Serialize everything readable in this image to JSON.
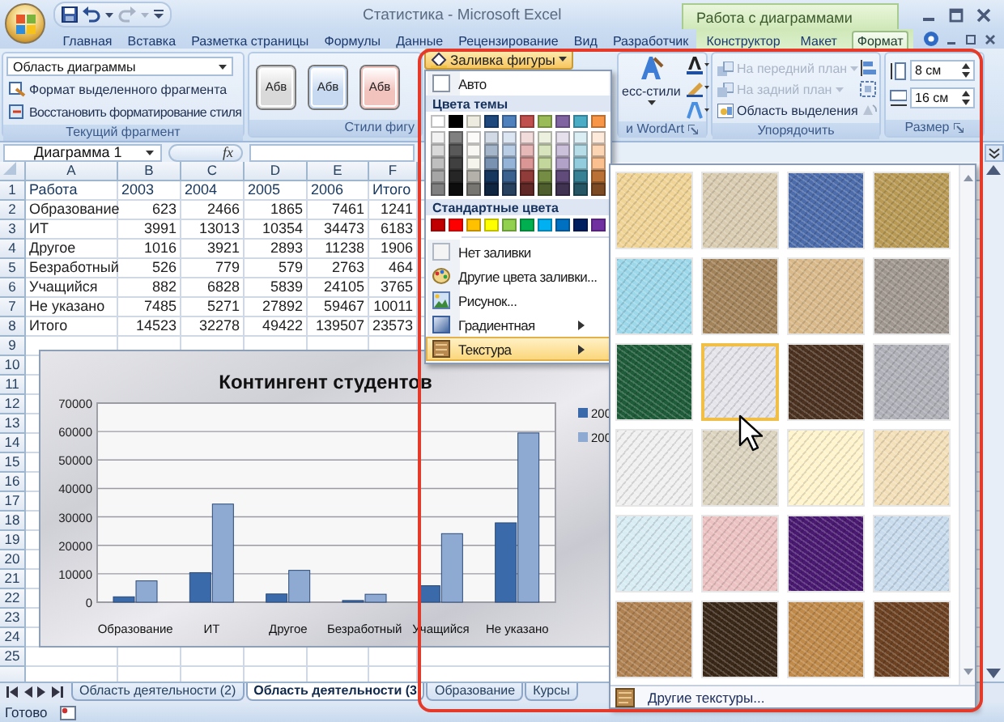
{
  "window": {
    "title": "Статистика - Microsoft Excel",
    "context_title": "Работа с диаграммами"
  },
  "tabs": [
    {
      "label": "Главная",
      "kind": "standard",
      "selected": false
    },
    {
      "label": "Вставка",
      "kind": "standard",
      "selected": false
    },
    {
      "label": "Разметка страницы",
      "kind": "standard",
      "selected": false
    },
    {
      "label": "Формулы",
      "kind": "standard",
      "selected": false
    },
    {
      "label": "Данные",
      "kind": "standard",
      "selected": false
    },
    {
      "label": "Рецензирование",
      "kind": "standard",
      "selected": false
    },
    {
      "label": "Вид",
      "kind": "standard",
      "selected": false
    },
    {
      "label": "Разработчик",
      "kind": "standard",
      "selected": false
    },
    {
      "label": "Конструктор",
      "kind": "contextual",
      "selected": false
    },
    {
      "label": "Макет",
      "kind": "contextual",
      "selected": false
    },
    {
      "label": "Формат",
      "kind": "contextual",
      "selected": true
    }
  ],
  "ribbon": {
    "current_selection": {
      "element_box": "Область диаграммы",
      "format_selection": "Формат выделенного фрагмента",
      "reset_style": "Восстановить форматирование стиля",
      "group_label": "Текущий фрагмент"
    },
    "shape_styles": {
      "samples": [
        {
          "label": "Абв",
          "color": "#d9d9d9"
        },
        {
          "label": "Абв",
          "color": "#c6d9f1"
        },
        {
          "label": "Абв",
          "color": "#f2c2bd"
        }
      ],
      "group_label": "Стили фигу"
    },
    "wordart": {
      "quick_styles": "есс-стили",
      "group_label": "и WordArt"
    },
    "arrange": {
      "items": [
        {
          "label": "На передний план",
          "disabled": true
        },
        {
          "label": "На задний план",
          "disabled": true
        },
        {
          "label": "Область выделения",
          "disabled": false
        }
      ],
      "group_label": "Упорядочить"
    },
    "size": {
      "height": "8 см",
      "width": "16 см",
      "group_label": "Размер"
    }
  },
  "formula_bar": {
    "name_box": "Диаграмма 1",
    "function_button": "fx"
  },
  "sheet": {
    "columns": [
      "A",
      "B",
      "C",
      "D",
      "E",
      "F"
    ],
    "rows": [
      {
        "number": "1",
        "kind": "header",
        "cells": [
          "Работа",
          "2003",
          "2004",
          "2005",
          "2006",
          "Итого"
        ]
      },
      {
        "number": "2",
        "kind": "data",
        "cells": [
          "Образование",
          "623",
          "2466",
          "1865",
          "7461",
          "1241"
        ]
      },
      {
        "number": "3",
        "kind": "data",
        "cells": [
          "ИТ",
          "3991",
          "13013",
          "10354",
          "34473",
          "6183"
        ]
      },
      {
        "number": "4",
        "kind": "data",
        "cells": [
          "Другое",
          "1016",
          "3921",
          "2893",
          "11238",
          "1906"
        ]
      },
      {
        "number": "5",
        "kind": "data",
        "cells": [
          "Безработный",
          "526",
          "779",
          "579",
          "2763",
          "464"
        ]
      },
      {
        "number": "6",
        "kind": "data",
        "cells": [
          "Учащийся",
          "882",
          "6828",
          "5839",
          "24105",
          "3765"
        ]
      },
      {
        "number": "7",
        "kind": "data",
        "cells": [
          "Не указано",
          "7485",
          "5271",
          "27892",
          "59467",
          "10011"
        ]
      },
      {
        "number": "8",
        "kind": "data",
        "cells": [
          "Итого",
          "14523",
          "32278",
          "49422",
          "139507",
          "23573"
        ]
      },
      {
        "number": "9"
      },
      {
        "number": "10"
      },
      {
        "number": "11"
      },
      {
        "number": "12"
      },
      {
        "number": "13"
      },
      {
        "number": "14"
      },
      {
        "number": "15"
      },
      {
        "number": "16"
      },
      {
        "number": "17"
      },
      {
        "number": "18"
      },
      {
        "number": "19"
      },
      {
        "number": "20"
      },
      {
        "number": "21"
      },
      {
        "number": "22"
      },
      {
        "number": "23"
      },
      {
        "number": "24"
      },
      {
        "number": "25"
      }
    ]
  },
  "chart": {
    "chart_data": {
      "type": "bar",
      "title": "Контингент студентов",
      "categories": [
        "Образование",
        "ИТ",
        "Другое",
        "Безработный",
        "Учащийся",
        "Не указано"
      ],
      "series": [
        {
          "name": "200",
          "color": "#3a6aaa",
          "values": [
            1900,
            10400,
            2900,
            600,
            5800,
            27900
          ]
        },
        {
          "name": "200",
          "color": "#8eaad2",
          "values": [
            7500,
            34500,
            11200,
            2800,
            24100,
            59500
          ]
        }
      ],
      "grid": true,
      "ylim": [
        0,
        70000
      ],
      "yticks": [
        0,
        10000,
        20000,
        30000,
        40000,
        50000,
        60000,
        70000
      ]
    }
  },
  "fill_menu": {
    "button": "Заливка фигуры",
    "auto": "Авто",
    "theme_heading": "Цвета темы",
    "theme_colors": [
      {
        "color": "#ffffff"
      },
      {
        "color": "#000000"
      },
      {
        "color": "#eeece1"
      },
      {
        "color": "#1f497d"
      },
      {
        "color": "#4f81bd"
      },
      {
        "color": "#c0504d"
      },
      {
        "color": "#9bbb59"
      },
      {
        "color": "#8064a2"
      },
      {
        "color": "#4bacc6"
      },
      {
        "color": "#f79646"
      }
    ],
    "standard_heading": "Стандартные цвета",
    "standard_colors": [
      {
        "color": "#c00000"
      },
      {
        "color": "#ff0000"
      },
      {
        "color": "#ffc000"
      },
      {
        "color": "#ffff00"
      },
      {
        "color": "#92d050"
      },
      {
        "color": "#00b050"
      },
      {
        "color": "#00b0f0"
      },
      {
        "color": "#0070c0"
      },
      {
        "color": "#002060"
      },
      {
        "color": "#7030a0"
      }
    ],
    "items": [
      {
        "label": "Нет заливки",
        "kind": "plain",
        "selected": false
      },
      {
        "label": "Другие цвета заливки...",
        "kind": "plain",
        "selected": false
      },
      {
        "label": "Рисунок...",
        "kind": "plain",
        "selected": false
      },
      {
        "label": "Градиентная",
        "kind": "submenu",
        "selected": false
      },
      {
        "label": "Текстура",
        "kind": "submenu",
        "selected": true
      }
    ]
  },
  "texture_gallery": {
    "tiles": [
      {
        "color": "#f0d496",
        "selected": false
      },
      {
        "color": "#d9ccb0",
        "selected": false
      },
      {
        "color": "#4c6cab",
        "selected": false
      },
      {
        "color": "#b89a55",
        "selected": false
      },
      {
        "color": "#9cd8ea",
        "selected": false
      },
      {
        "color": "#a4845a",
        "selected": false
      },
      {
        "color": "#d9b98a",
        "selected": false
      },
      {
        "color": "#a09890",
        "selected": false
      },
      {
        "color": "#1f5c3a",
        "selected": false
      },
      {
        "color": "#e4e4ea",
        "selected": true
      },
      {
        "color": "#4c3220",
        "selected": false
      },
      {
        "color": "#b0b0b8",
        "selected": false
      },
      {
        "color": "#f0f0f0",
        "selected": false
      },
      {
        "color": "#ddd4c0",
        "selected": false
      },
      {
        "color": "#fff4cc",
        "selected": false
      },
      {
        "color": "#f4e0b8",
        "selected": false
      },
      {
        "color": "#d8ecf4",
        "selected": false
      },
      {
        "color": "#ecc2c2",
        "selected": false
      },
      {
        "color": "#4a1a72",
        "selected": false
      },
      {
        "color": "#c8dcee",
        "selected": false
      },
      {
        "color": "#b08252",
        "selected": false
      },
      {
        "color": "#3a2818",
        "selected": false
      },
      {
        "color": "#c08a4a",
        "selected": false
      },
      {
        "color": "#6c4222",
        "selected": false
      }
    ],
    "more": "Другие текстуры..."
  },
  "sheet_tabs": [
    {
      "label": "Область деятельности (2)",
      "selected": false
    },
    {
      "label": "Область деятельности (3",
      "selected": true
    },
    {
      "label": "Образование",
      "selected": false
    },
    {
      "label": "Курсы",
      "selected": false
    }
  ],
  "status_bar": {
    "text": "Готово"
  }
}
